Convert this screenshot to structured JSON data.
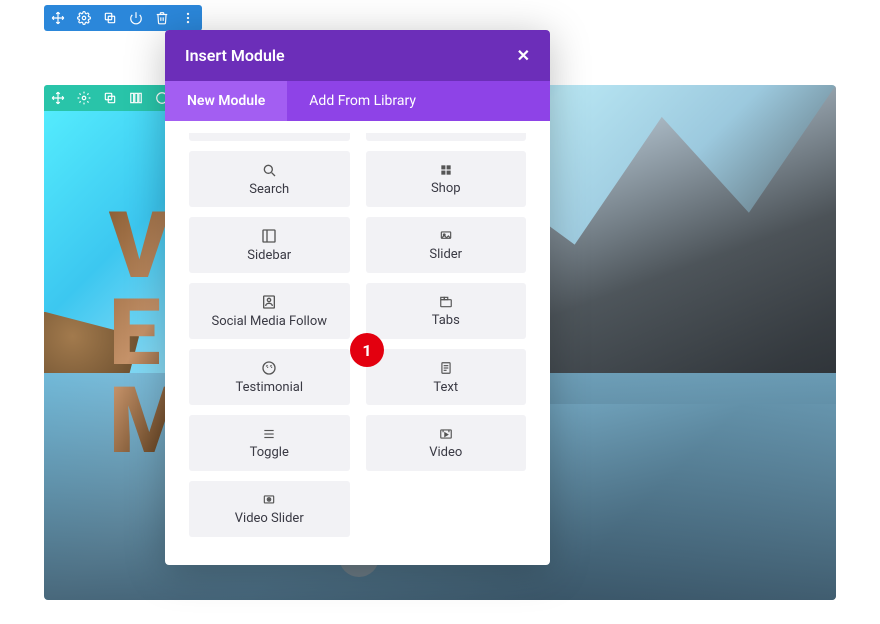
{
  "section_toolbar": {
    "icons": [
      "move-icon",
      "gear-icon",
      "duplicate-icon",
      "power-icon",
      "trash-icon",
      "more-icon"
    ]
  },
  "row_toolbar": {
    "icons": [
      "move-icon",
      "gear-icon",
      "duplicate-icon",
      "columns-icon",
      "code-icon"
    ]
  },
  "hero": {
    "line1": "V",
    "line2": "EX",
    "line3": "M"
  },
  "modal": {
    "title": "Insert Module",
    "tabs": {
      "new": "New Module",
      "library": "Add From Library"
    },
    "modules": [
      {
        "icon": "search-icon",
        "label": "Search"
      },
      {
        "icon": "shop-icon",
        "label": "Shop"
      },
      {
        "icon": "sidebar-icon",
        "label": "Sidebar"
      },
      {
        "icon": "slider-icon",
        "label": "Slider"
      },
      {
        "icon": "social-icon",
        "label": "Social Media Follow"
      },
      {
        "icon": "tabs-icon",
        "label": "Tabs"
      },
      {
        "icon": "testimonial-icon",
        "label": "Testimonial"
      },
      {
        "icon": "text-icon",
        "label": "Text"
      },
      {
        "icon": "toggle-icon",
        "label": "Toggle"
      },
      {
        "icon": "video-icon",
        "label": "Video"
      },
      {
        "icon": "video-slider-icon",
        "label": "Video Slider"
      }
    ]
  },
  "callout": {
    "number": "1"
  },
  "colors": {
    "blue": "#2b87da",
    "green": "#29c4a9",
    "purple_dark": "#6c2eb9",
    "purple": "#8e43e7",
    "purple_light": "#a35ef2",
    "red": "#e3000f",
    "card_bg": "#f2f2f5"
  }
}
